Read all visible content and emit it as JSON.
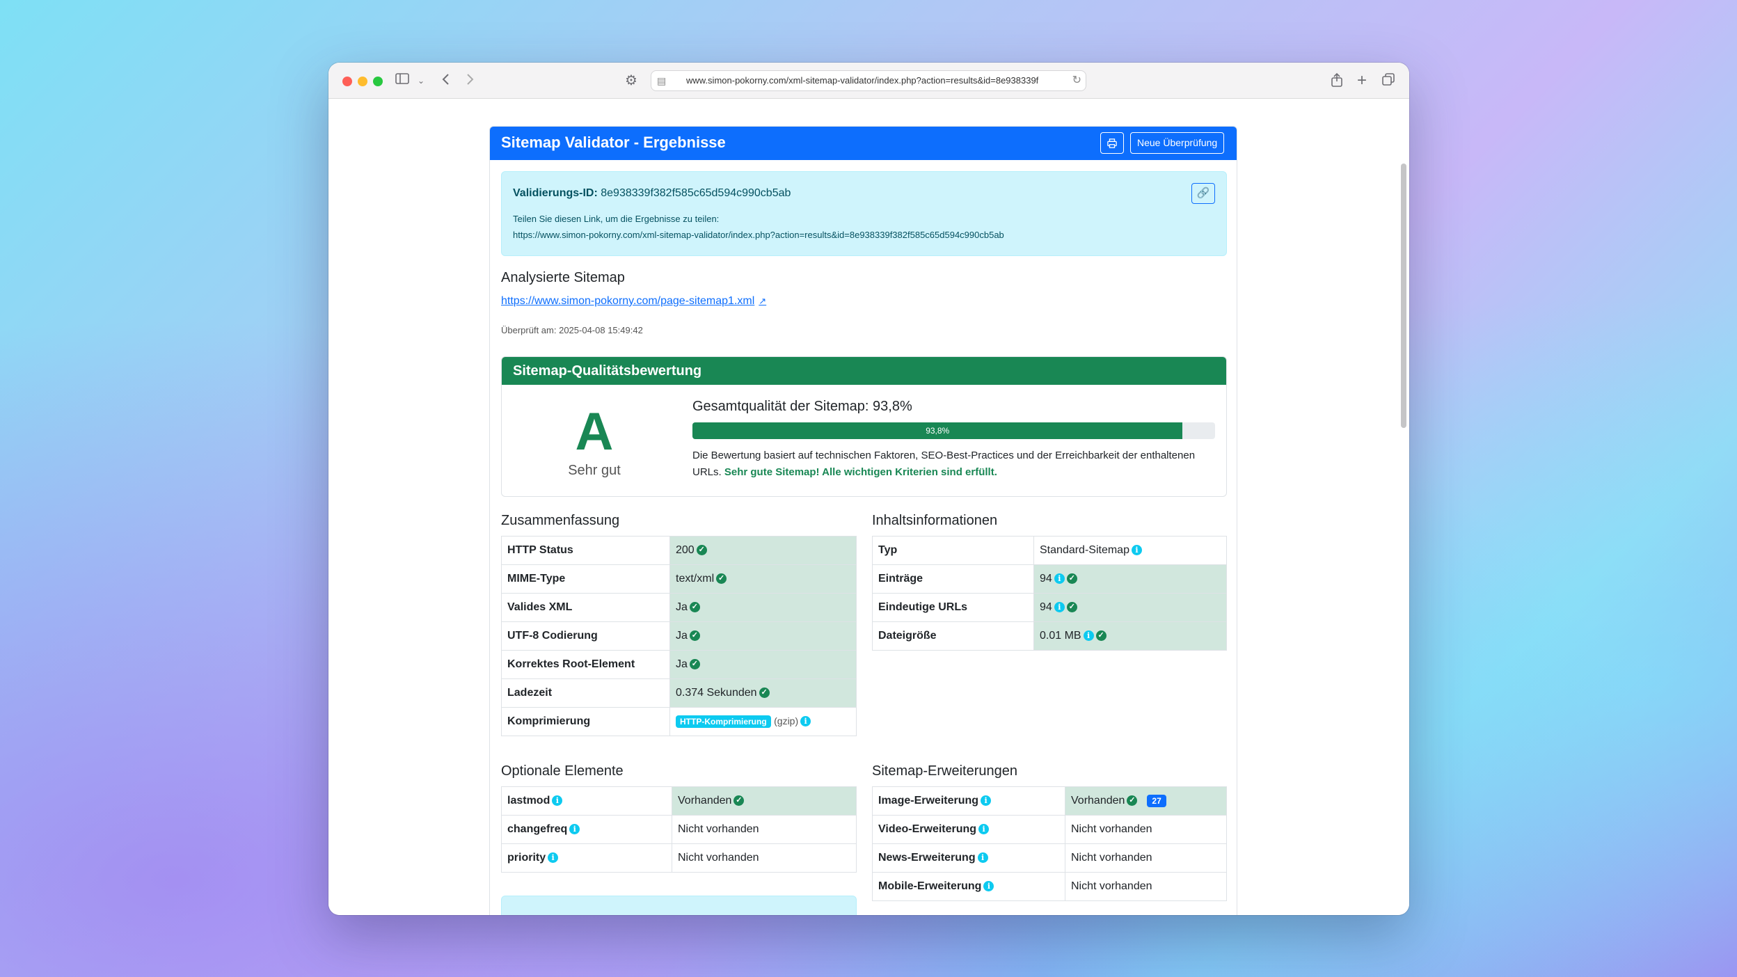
{
  "browser": {
    "url": "www.simon-pokorny.com/xml-sitemap-validator/index.php?action=results&id=8e938339f"
  },
  "header": {
    "title": "Sitemap Validator - Ergebnisse",
    "new_check_label": "Neue Überprüfung"
  },
  "validation": {
    "id_label": "Validierungs-ID:",
    "id_value": "8e938339f382f585c65d594c990cb5ab",
    "share_text": "Teilen Sie diesen Link, um die Ergebnisse zu teilen:",
    "share_url": "https://www.simon-pokorny.com/xml-sitemap-validator/index.php?action=results&id=8e938339f382f585c65d594c990cb5ab"
  },
  "analyzed": {
    "heading": "Analysierte Sitemap",
    "link": "https://www.simon-pokorny.com/page-sitemap1.xml",
    "checked_at": "Überprüft am: 2025-04-08 15:49:42"
  },
  "quality": {
    "heading": "Sitemap-Qualitätsbewertung",
    "grade": "A",
    "grade_label": "Sehr gut",
    "title": "Gesamtqualität der Sitemap: 93,8%",
    "progress_label": "93,8%",
    "progress_value": 93.8,
    "desc": "Die Bewertung basiert auf technischen Faktoren, SEO-Best-Practices und der Erreichbarkeit der enthaltenen URLs.",
    "desc_strong": "Sehr gute Sitemap! Alle wichtigen Kriterien sind erfüllt."
  },
  "summary": {
    "heading": "Zusammenfassung",
    "rows": [
      {
        "k": "HTTP Status",
        "v": "200"
      },
      {
        "k": "MIME-Type",
        "v": "text/xml"
      },
      {
        "k": "Valides XML",
        "v": "Ja"
      },
      {
        "k": "UTF-8 Codierung",
        "v": "Ja"
      },
      {
        "k": "Korrektes Root-Element",
        "v": "Ja"
      },
      {
        "k": "Ladezeit",
        "v": "0.374 Sekunden"
      },
      {
        "k": "Komprimierung",
        "badge": "HTTP-Komprimierung",
        "extra": "(gzip)"
      }
    ]
  },
  "content_info": {
    "heading": "Inhaltsinformationen",
    "rows": [
      {
        "k": "Typ",
        "v": "Standard-Sitemap"
      },
      {
        "k": "Einträge",
        "v": "94"
      },
      {
        "k": "Eindeutige URLs",
        "v": "94"
      },
      {
        "k": "Dateigröße",
        "v": "0.01 MB"
      }
    ]
  },
  "optional": {
    "heading": "Optionale Elemente",
    "rows": [
      {
        "k": "lastmod",
        "v": "Vorhanden"
      },
      {
        "k": "changefreq",
        "v": "Nicht vorhanden"
      },
      {
        "k": "priority",
        "v": "Nicht vorhanden"
      }
    ]
  },
  "extensions": {
    "heading": "Sitemap-Erweiterungen",
    "rows": [
      {
        "k": "Image-Erweiterung",
        "v": "Vorhanden",
        "count": "27"
      },
      {
        "k": "Video-Erweiterung",
        "v": "Nicht vorhanden"
      },
      {
        "k": "News-Erweiterung",
        "v": "Nicht vorhanden"
      },
      {
        "k": "Mobile-Erweiterung",
        "v": "Nicht vorhanden"
      }
    ]
  },
  "icons": {
    "check": "check-circle-icon",
    "info": "info-circle-icon",
    "print": "printer-icon",
    "link": "link-icon",
    "external": "external-link-icon"
  },
  "colors": {
    "primary": "#0d6efd",
    "success": "#198754",
    "info_bg": "#cff4fc",
    "success_bg": "#d1e7dd"
  }
}
